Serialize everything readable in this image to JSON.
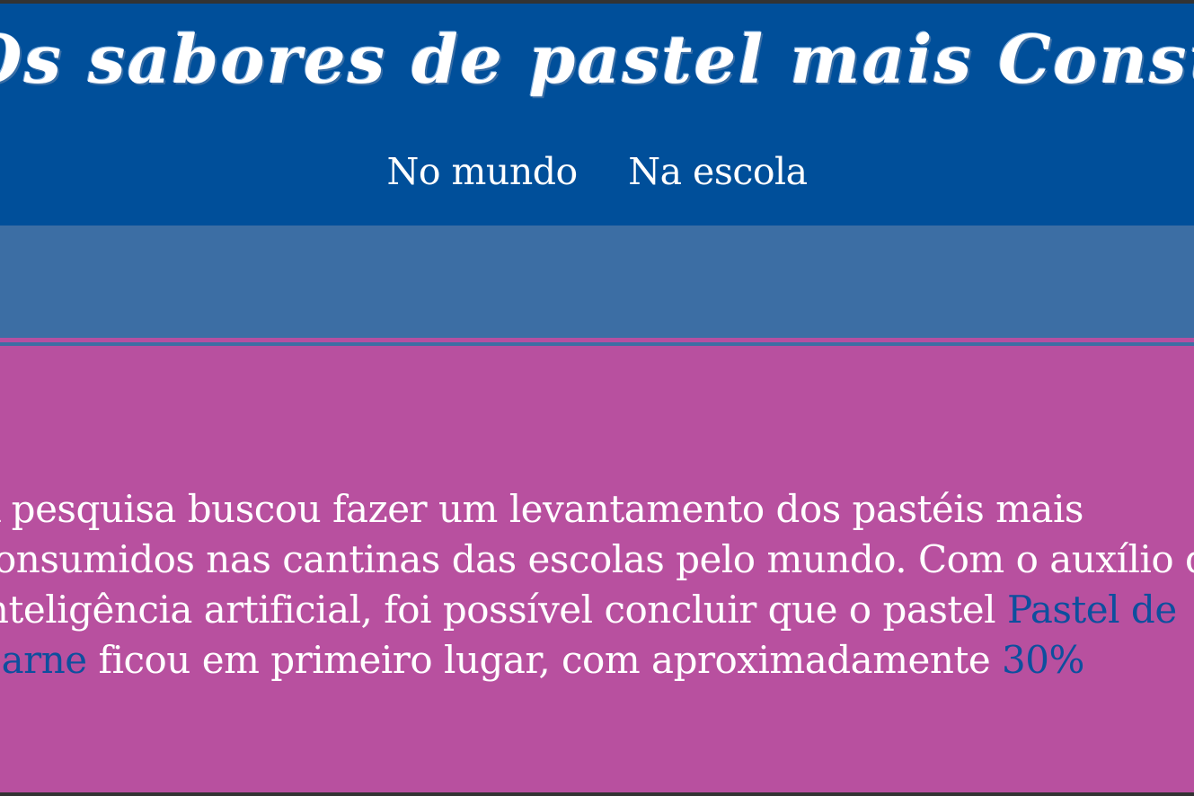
{
  "header": {
    "title": "Os sabores de pastel mais Consumidos",
    "nav": [
      "No mundo",
      "Na escola"
    ]
  },
  "content": {
    "lines": [
      {
        "before": "A pesquisa buscou fazer um levantamento dos pastéis mais",
        "highlight": "",
        "after": ""
      },
      {
        "before": "consumidos nas cantinas das escolas pelo mundo. Com o auxílio da",
        "highlight": "",
        "after": ""
      },
      {
        "before": "inteligência artificial, foi possível concluir que o pastel ",
        "highlight": "Pastel de",
        "after": ""
      },
      {
        "before": "",
        "highlight": "Carne",
        "after": " ficou em primeiro lugar, com aproximadamente ",
        "highlight2": "30%"
      }
    ]
  },
  "colors": {
    "header_bg": "#004f9a",
    "band_bg": "#3c6ea4",
    "content_bg": "#b8509f",
    "highlight_text": "#0d4f9e",
    "text": "#ffffff"
  }
}
